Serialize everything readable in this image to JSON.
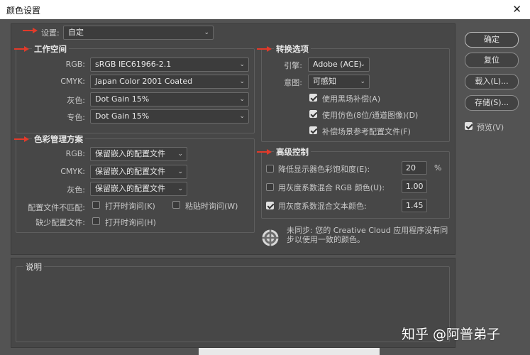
{
  "window": {
    "title": "颜色设置",
    "close_glyph": "✕"
  },
  "settings": {
    "label": "设置:",
    "value": "自定"
  },
  "working_spaces": {
    "header": "工作空间",
    "rows": [
      {
        "label": "RGB:",
        "value": "sRGB IEC61966-2.1"
      },
      {
        "label": "CMYK:",
        "value": "Japan Color 2001 Coated"
      },
      {
        "label": "灰色:",
        "value": "Dot Gain 15%"
      },
      {
        "label": "专色:",
        "value": "Dot Gain 15%"
      }
    ]
  },
  "color_management": {
    "header": "色彩管理方案",
    "rows": [
      {
        "label": "RGB:",
        "value": "保留嵌入的配置文件"
      },
      {
        "label": "CMYK:",
        "value": "保留嵌入的配置文件"
      },
      {
        "label": "灰色:",
        "value": "保留嵌入的配置文件"
      }
    ],
    "mismatch_label": "配置文件不匹配:",
    "mismatch_open": "打开时询问(K)",
    "mismatch_paste": "粘贴时询问(W)",
    "missing_label": "缺少配置文件:",
    "missing_open": "打开时询问(H)"
  },
  "conversion": {
    "header": "转换选项",
    "engine_label": "引擎:",
    "engine_value": "Adobe (ACE)",
    "intent_label": "意图:",
    "intent_value": "可感知",
    "blackpoint": "使用黑场补偿(A)",
    "dither": "使用仿色(8位/通道图像)(D)",
    "compensate": "补偿场景参考配置文件(F)"
  },
  "advanced": {
    "header": "高级控制",
    "desaturate_label": "降低显示器色彩饱和度(E):",
    "desaturate_value": "20",
    "desaturate_unit": "%",
    "blend_rgb_label": "用灰度系数混合 RGB 颜色(U):",
    "blend_rgb_value": "1.00",
    "blend_text_label": "用灰度系数混合文本颜色:",
    "blend_text_value": "1.45"
  },
  "sync": {
    "text_line1": "未同步: 您的 Creative Cloud 应用程序没有同",
    "text_line2": "步以使用一致的颜色。"
  },
  "description": {
    "header": "说明"
  },
  "buttons": {
    "ok": "确定",
    "reset": "复位",
    "load": "载入(L)...",
    "save": "存储(S)...",
    "preview": "预览(V)"
  },
  "states": {
    "blackpoint_checked": true,
    "dither_checked": true,
    "compensate_checked": true,
    "desaturate_checked": false,
    "blend_rgb_checked": false,
    "blend_text_checked": true,
    "mismatch_open_checked": false,
    "mismatch_paste_checked": false,
    "missing_open_checked": false,
    "preview_checked": true
  },
  "watermark": "知乎 @阿普弟子",
  "colors": {
    "annotation_arrow": "#e23a2a",
    "dialog_bg": "#535353",
    "panel_bg": "#474747"
  },
  "icons": {
    "sync": "sync-status-icon",
    "dropdown": "chevron-down-icon",
    "close": "close-icon"
  }
}
